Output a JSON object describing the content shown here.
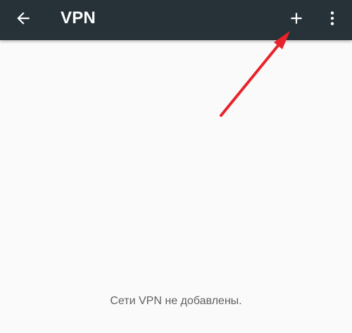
{
  "toolbar": {
    "title": "VPN",
    "background_color": "#263238",
    "back_icon": "arrow-back-icon",
    "add_icon": "plus-icon",
    "overflow_icon": "more-vert-icon"
  },
  "content": {
    "empty_message": "Сети VPN не добавлены."
  },
  "annotation": {
    "arrow_color": "#e8232a",
    "icon": "red-arrow"
  }
}
